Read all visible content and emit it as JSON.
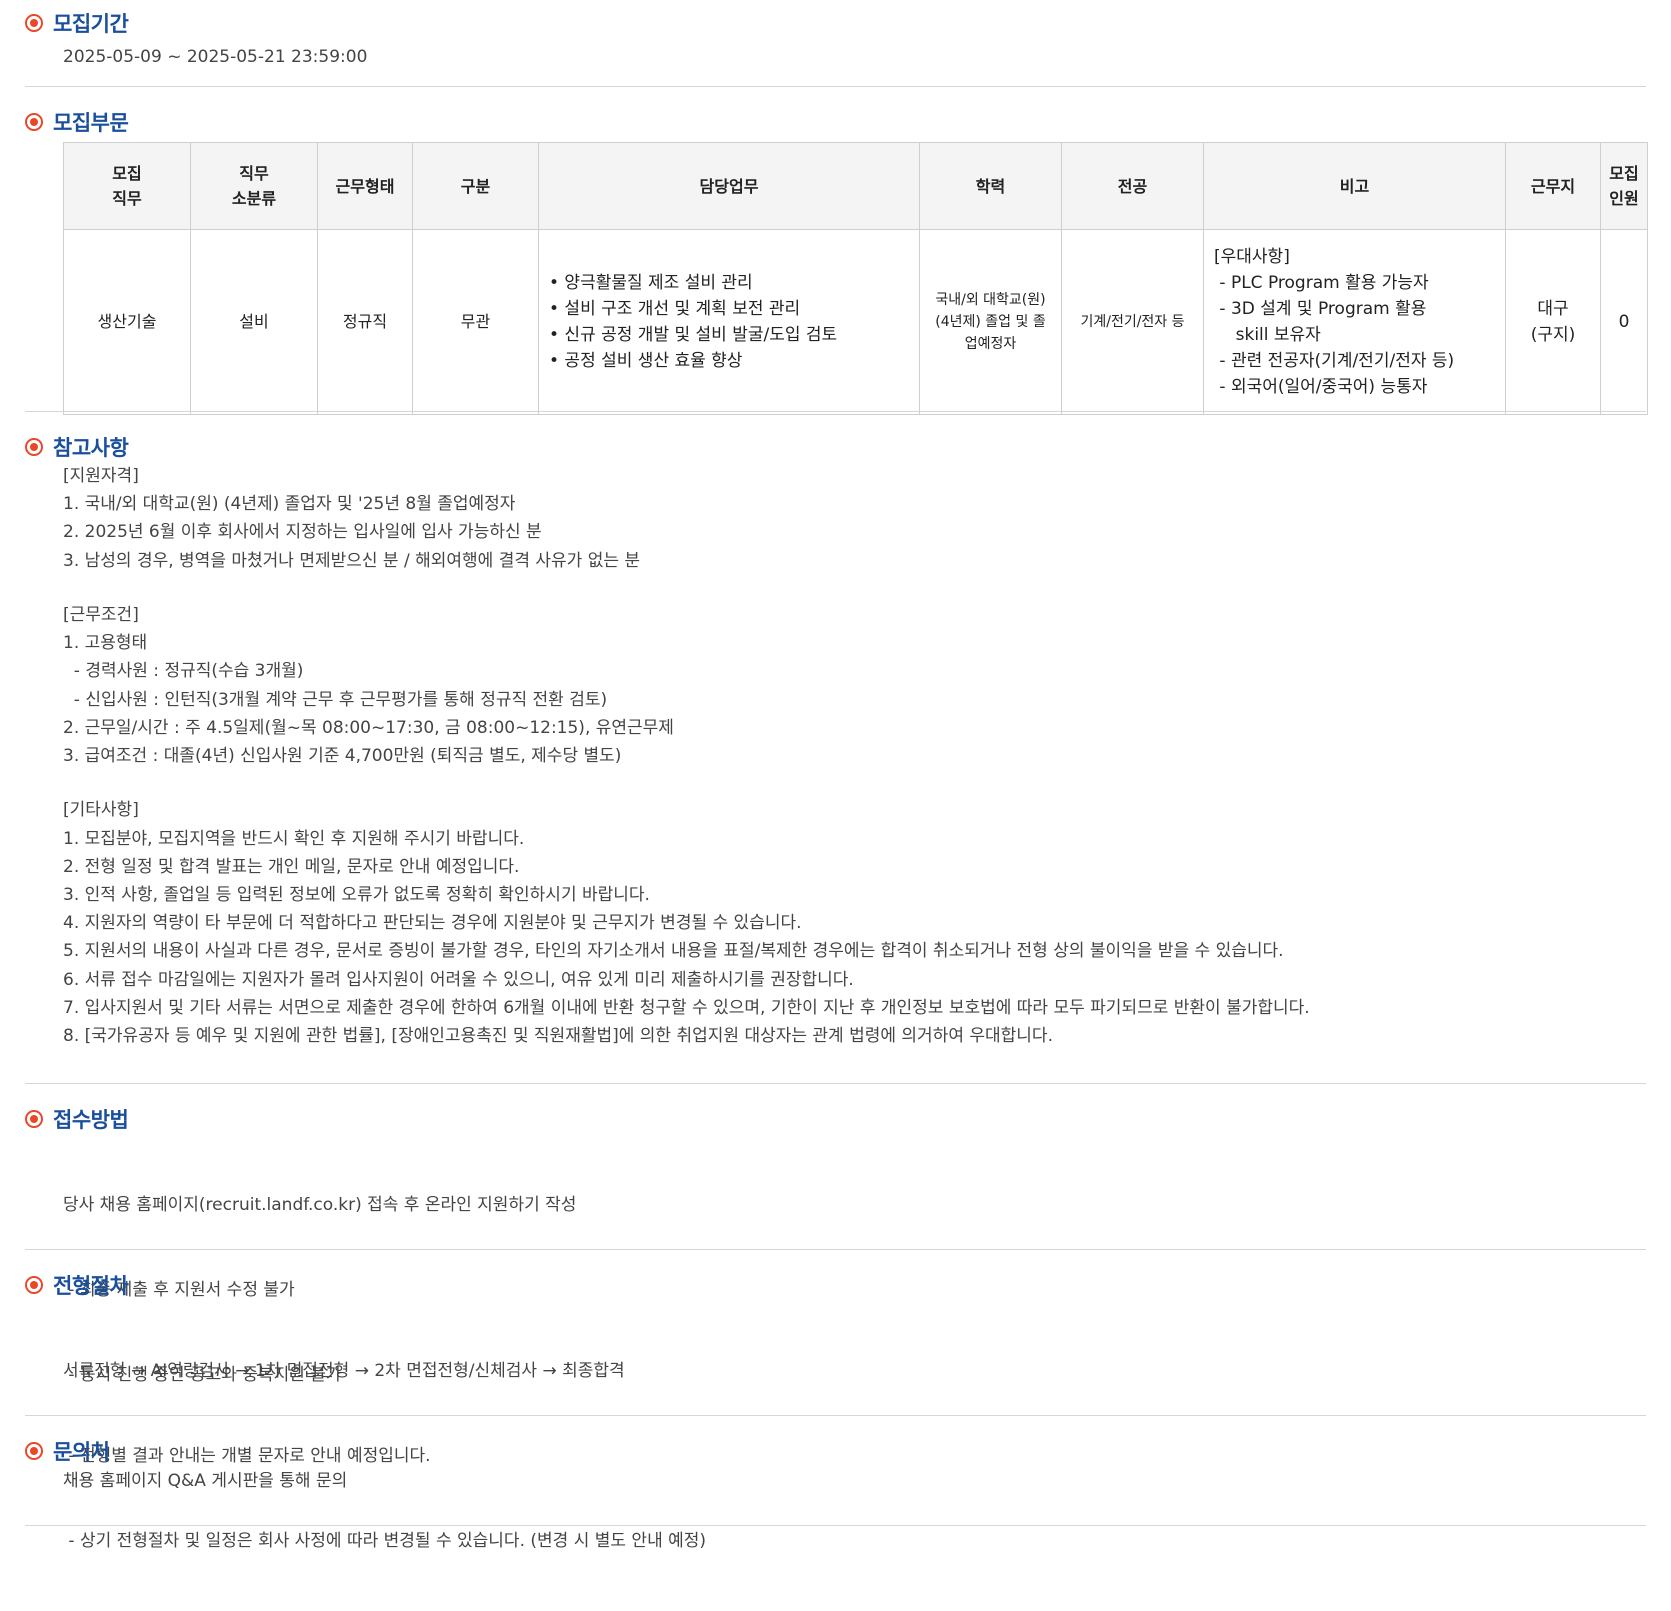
{
  "period": {
    "title": "모집기간",
    "value": "2025-05-09 ~ 2025-05-21 23:59:00"
  },
  "division": {
    "title": "모집부문",
    "headers": [
      "모집\n직무",
      "직무\n소분류",
      "근무형태",
      "구분",
      "담당업무",
      "학력",
      "전공",
      "비고",
      "근무지",
      "모집\n인원"
    ],
    "row": {
      "job": "생산기술",
      "subclass": "설비",
      "employment": "정규직",
      "category": "무관",
      "duties": [
        "• 양극활물질 제조 설비 관리",
        "• 설비 구조 개선 및 계획 보전 관리",
        "• 신규 공정 개발 및 설비 발굴/도입 검토",
        "• 공정 설비 생산 효율 향상"
      ],
      "education": "국내/외 대학교(원)\n(4년제) 졸업 및 졸\n업예정자",
      "major": "기계/전기/전자 등",
      "remarks": [
        "[우대사항]",
        " - PLC Program 활용 가능자",
        " - 3D 설계 및 Program 활용",
        "    skill 보유자",
        " - 관련 전공자(기계/전기/전자 등)",
        " - 외국어(일어/중국어) 능통자"
      ],
      "location": "대구\n(구지)",
      "headcount": "0"
    }
  },
  "notes": {
    "title": "참고사항",
    "lines": [
      "[지원자격]",
      "1. 국내/외 대학교(원) (4년제) 졸업자 및 '25년 8월 졸업예정자",
      "2. 2025년 6월 이후 회사에서 지정하는 입사일에 입사 가능하신 분",
      "3. 남성의 경우, 병역을 마쳤거나 면제받으신 분 / 해외여행에 결격 사유가 없는 분",
      "",
      "[근무조건]",
      "1. 고용형태",
      "  - 경력사원 : 정규직(수습 3개월)",
      "  - 신입사원 : 인턴직(3개월 계약 근무 후 근무평가를 통해 정규직 전환 검토)",
      "2. 근무일/시간 : 주 4.5일제(월~목 08:00~17:30, 금 08:00~12:15), 유연근무제",
      "3. 급여조건 : 대졸(4년) 신입사원 기준 4,700만원 (퇴직금 별도, 제수당 별도)",
      "",
      "[기타사항]",
      "1. 모집분야, 모집지역을 반드시 확인 후 지원해 주시기 바랍니다.",
      "2. 전형 일정 및 합격 발표는 개인 메일, 문자로 안내 예정입니다.",
      "3. 인적 사항, 졸업일 등 입력된 정보에 오류가 없도록 정확히 확인하시기 바랍니다.",
      "4. 지원자의 역량이 타 부문에 더 적합하다고 판단되는 경우에 지원분야 및 근무지가 변경될 수 있습니다.",
      "5. 지원서의 내용이 사실과 다른 경우, 문서로 증빙이 불가할 경우, 타인의 자기소개서 내용을 표절/복제한 경우에는 합격이 취소되거나 전형 상의 불이익을 받을 수 있습니다.",
      "6. 서류 접수 마감일에는 지원자가 몰려 입사지원이 어려울 수 있으니, 여유 있게 미리 제출하시기를 권장합니다.",
      "7. 입사지원서 및 기타 서류는 서면으로 제출한 경우에 한하여 6개월 이내에 반환 청구할 수 있으며, 기한이 지난 후 개인정보 보호법에 따라 모두 파기되므로 반환이 불가합니다.",
      "8. [국가유공자 등 예우 및 지원에 관한 법률], [장애인고용촉진 및 직원재활법]에 의한 취업지원 대상자는 관계 법령에 의거하여 우대합니다."
    ]
  },
  "apply": {
    "title": "접수방법",
    "lines": [
      "당사 채용 홈페이지(recruit.landf.co.kr) 접속 후 온라인 지원하기 작성",
      " - 최종 제출 후 지원서 수정 불가",
      " - 동시 진행 중인 공고와 중복지원 불가"
    ]
  },
  "process": {
    "title": "전형절차",
    "lines": [
      "서류전형 → AI역량검사 → 1차 면접전형 → 2차 면접전형/신체검사 → 최종합격",
      " - 전형별 결과 안내는 개별 문자로 안내 예정입니다.",
      " - 상기 전형절차 및 일정은 회사 사정에 따라 변경될 수 있습니다. (변경 시 별도 안내 예정)"
    ]
  },
  "contact": {
    "title": "문의처",
    "value": "채용 홈페이지 Q&A 게시판을 통해 문의"
  },
  "colors": {
    "accent_red": "#e8482a",
    "title_blue": "#1a4f9c"
  }
}
